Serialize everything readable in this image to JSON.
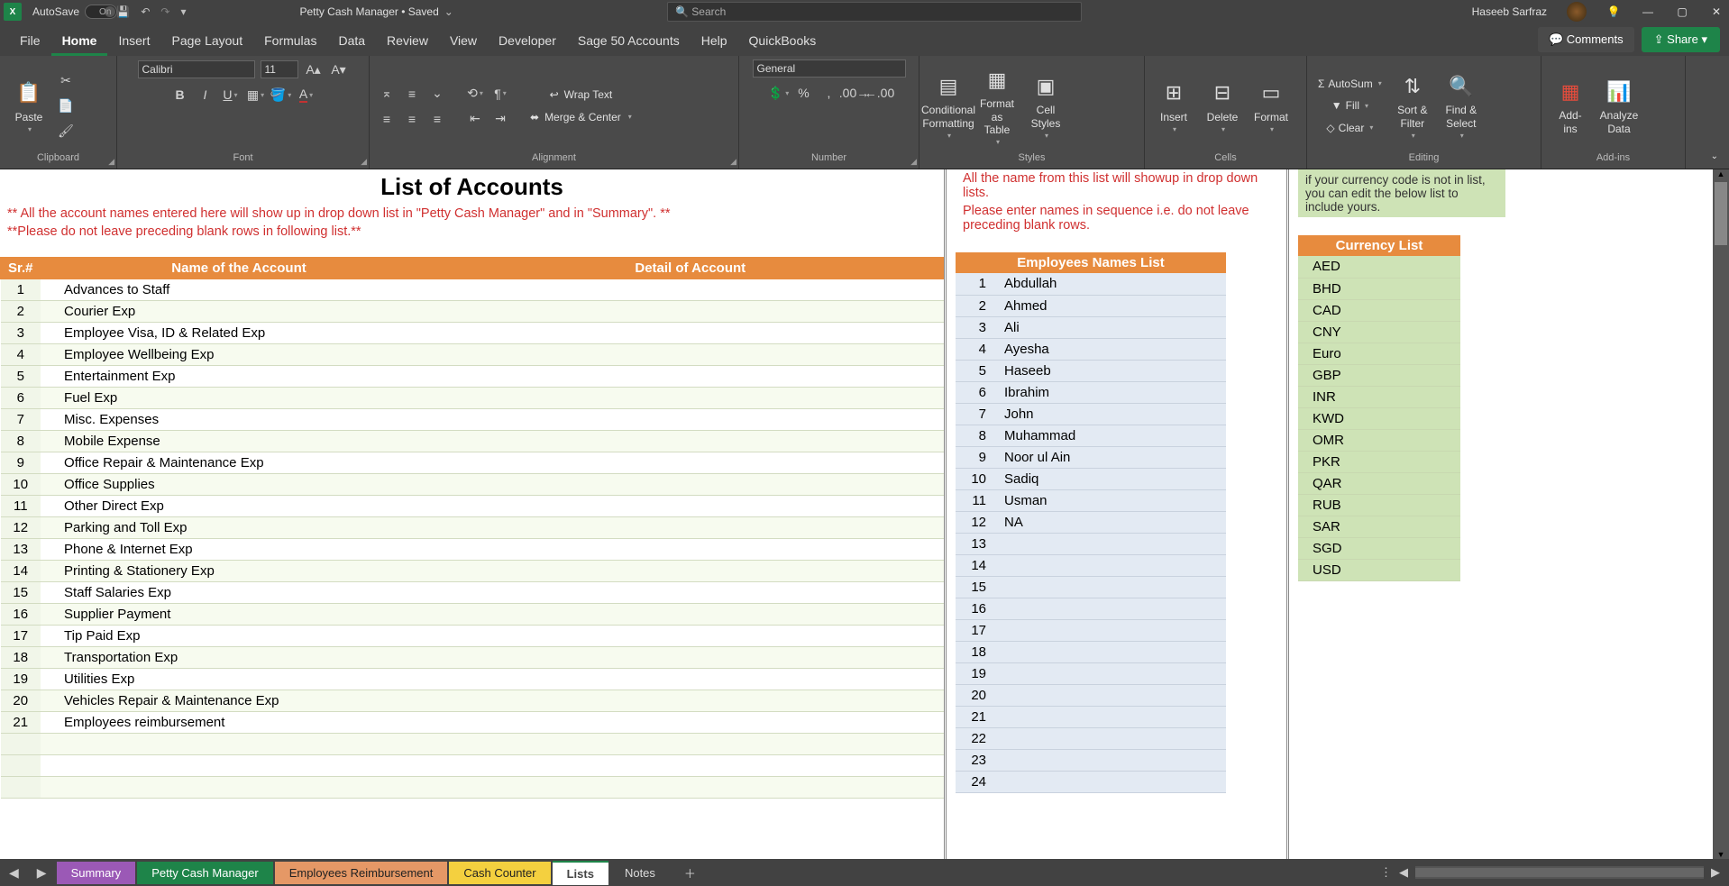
{
  "titlebar": {
    "autosave": "AutoSave",
    "autosave_state": "On",
    "doc_title": "Petty Cash Manager • Saved",
    "search_placeholder": "Search",
    "user_name": "Haseeb Sarfraz"
  },
  "tabs": [
    "File",
    "Home",
    "Insert",
    "Page Layout",
    "Formulas",
    "Data",
    "Review",
    "View",
    "Developer",
    "Sage 50 Accounts",
    "Help",
    "QuickBooks"
  ],
  "active_tab": "Home",
  "top_right": {
    "comments": "Comments",
    "share": "Share"
  },
  "ribbon": {
    "clipboard": {
      "label": "Clipboard",
      "paste": "Paste"
    },
    "font": {
      "label": "Font",
      "name": "Calibri",
      "size": "11"
    },
    "alignment": {
      "label": "Alignment",
      "wrap": "Wrap Text",
      "merge": "Merge & Center"
    },
    "number": {
      "label": "Number",
      "format": "General"
    },
    "styles": {
      "label": "Styles",
      "cf": "Conditional Formatting",
      "fat": "Format as Table",
      "cs": "Cell Styles"
    },
    "cells": {
      "label": "Cells",
      "insert": "Insert",
      "delete": "Delete",
      "format": "Format"
    },
    "editing": {
      "label": "Editing",
      "autosum": "AutoSum",
      "fill": "Fill",
      "clear": "Clear",
      "sort": "Sort & Filter",
      "find": "Find & Select"
    },
    "addins": {
      "label": "Add-ins",
      "addins": "Add-ins",
      "analyze": "Analyze Data"
    }
  },
  "sheet": {
    "title": "List of Accounts",
    "warn1": "** All the account names entered here will show up in drop down list in \"Petty Cash Manager\" and in \"Summary\". **",
    "warn2": "**Please do not leave preceding blank rows in following list.**",
    "cols": {
      "sr": "Sr.#",
      "name": "Name of the Account",
      "detail": "Detail of Account"
    },
    "accounts": [
      "Advances to Staff",
      "Courier Exp",
      "Employee Visa, ID & Related Exp",
      "Employee Wellbeing Exp",
      "Entertainment Exp",
      "Fuel Exp",
      "Misc. Expenses",
      "Mobile Expense",
      "Office Repair & Maintenance Exp",
      "Office Supplies",
      "Other Direct Exp",
      "Parking and Toll Exp",
      "Phone & Internet Exp",
      "Printing & Stationery Exp",
      "Staff Salaries Exp",
      "Supplier Payment",
      "Tip Paid Exp",
      "Transportation Exp",
      "Utilities Exp",
      "Vehicles Repair & Maintenance Exp",
      "Employees reimbursement"
    ],
    "emp_note1": "All the name from this list will showup in drop down lists.",
    "emp_note2": "Please enter names in sequence i.e. do not leave preceding blank rows.",
    "emp_header": "Employees Names List",
    "employees": [
      "Abdullah",
      "Ahmed",
      "Ali",
      "Ayesha",
      "Haseeb",
      "Ibrahim",
      "John",
      "Muhammad",
      "Noor ul Ain",
      "Sadiq",
      "Usman",
      "NA"
    ],
    "emp_blank_rows": [
      13,
      14,
      15,
      16,
      17,
      18,
      19,
      20,
      21,
      22,
      23,
      24
    ],
    "cur_note": "if your currency code is not in list, you can edit the below list to include yours.",
    "cur_header": "Currency List",
    "currencies": [
      "AED",
      "BHD",
      "CAD",
      "CNY",
      "Euro",
      "GBP",
      "INR",
      "KWD",
      "OMR",
      "PKR",
      "QAR",
      "RUB",
      "SAR",
      "SGD",
      "USD"
    ]
  },
  "sheet_tabs": {
    "summary": "Summary",
    "pcm": "Petty Cash Manager",
    "reimb": "Employees Reimbursement",
    "cash": "Cash  Counter",
    "lists": "Lists",
    "notes": "Notes"
  }
}
